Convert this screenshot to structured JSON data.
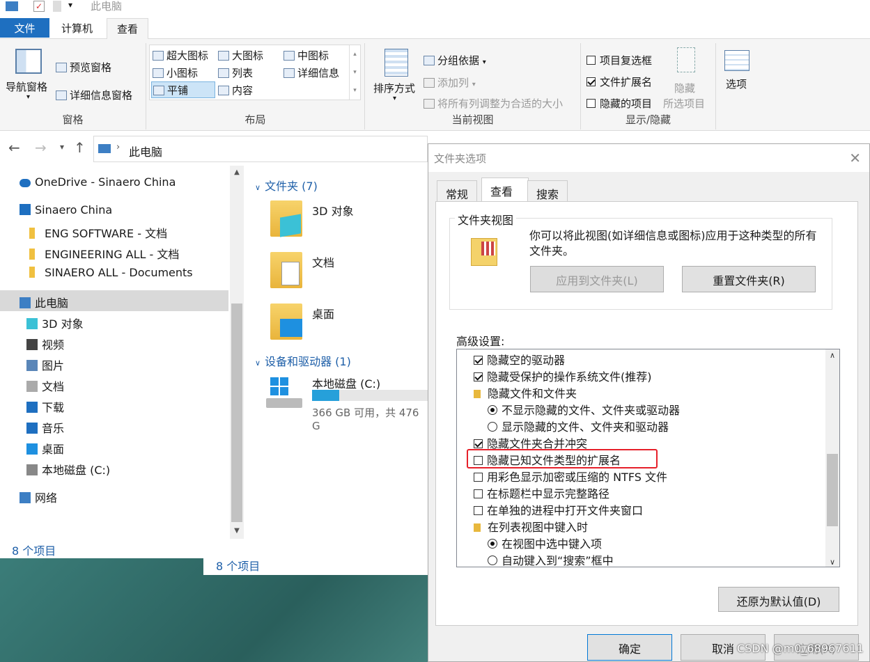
{
  "window": {
    "title": "此电脑"
  },
  "ribbon": {
    "tabs": [
      "文件",
      "计算机",
      "查看"
    ],
    "panes": {
      "nav_pane": "导航窗格",
      "preview": "预览窗格",
      "details": "详细信息窗格",
      "label": "窗格"
    },
    "layout": {
      "items": [
        "超大图标",
        "大图标",
        "中图标",
        "小图标",
        "列表",
        "详细信息",
        "平铺",
        "内容"
      ],
      "selected": "平铺",
      "label": "布局"
    },
    "current_view": {
      "sort": "排序方式",
      "group": "分组依据",
      "add_col": "添加列",
      "fit_cols": "将所有列调整为合适的大小",
      "label": "当前视图"
    },
    "show_hide": {
      "item_checkbox": "项目复选框",
      "file_ext": "文件扩展名",
      "hidden_items": "隐藏的项目",
      "hide_btn": "隐藏",
      "hide_btn2": "所选项目",
      "label": "显示/隐藏",
      "file_ext_checked": true,
      "item_checkbox_checked": false,
      "hidden_items_checked": false
    },
    "options": "选项"
  },
  "address": {
    "path": "此电脑"
  },
  "nav": [
    {
      "label": "OneDrive - Sinaero China",
      "icon": "cloud-icon"
    },
    {
      "label": "Sinaero China",
      "icon": "building-icon"
    },
    {
      "label": "ENG SOFTWARE - 文档",
      "icon": "folder-icon"
    },
    {
      "label": "ENGINEERING ALL - 文档",
      "icon": "folder-icon"
    },
    {
      "label": "SINAERO ALL - Documents",
      "icon": "folder-icon"
    },
    {
      "label": "此电脑",
      "icon": "computer-icon"
    },
    {
      "label": "3D 对象",
      "icon": "cube-icon"
    },
    {
      "label": "视频",
      "icon": "video-icon"
    },
    {
      "label": "图片",
      "icon": "picture-icon"
    },
    {
      "label": "文档",
      "icon": "document-icon"
    },
    {
      "label": "下载",
      "icon": "download-icon"
    },
    {
      "label": "音乐",
      "icon": "music-icon"
    },
    {
      "label": "桌面",
      "icon": "desktop-icon"
    },
    {
      "label": "本地磁盘 (C:)",
      "icon": "drive-icon"
    },
    {
      "label": "网络",
      "icon": "network-icon"
    }
  ],
  "content": {
    "folders_header": "文件夹 (7)",
    "folders": [
      "3D 对象",
      "文档",
      "桌面"
    ],
    "drives_header": "设备和驱动器 (1)",
    "drive": {
      "name": "本地磁盘 (C:)",
      "info": "366 GB 可用，共 476 G",
      "used_fraction": 0.23
    }
  },
  "status": {
    "count": "8 个项目",
    "count2": "8 个项目"
  },
  "dialog": {
    "title": "文件夹选项",
    "tabs": [
      "常规",
      "查看",
      "搜索"
    ],
    "folder_view": {
      "label": "文件夹视图",
      "desc": "你可以将此视图(如详细信息或图标)应用于这种类型的所有文件夹。",
      "apply": "应用到文件夹(L)",
      "reset": "重置文件夹(R)"
    },
    "advanced_label": "高级设置:",
    "advanced": [
      {
        "type": "check",
        "checked": true,
        "label": "隐藏空的驱动器"
      },
      {
        "type": "check",
        "checked": true,
        "label": "隐藏受保护的操作系统文件(推荐)"
      },
      {
        "type": "folder",
        "label": "隐藏文件和文件夹"
      },
      {
        "type": "radio",
        "checked": true,
        "label": "不显示隐藏的文件、文件夹或驱动器"
      },
      {
        "type": "radio",
        "checked": false,
        "label": "显示隐藏的文件、文件夹和驱动器"
      },
      {
        "type": "check",
        "checked": true,
        "label": "隐藏文件夹合并冲突"
      },
      {
        "type": "check",
        "checked": false,
        "label": "隐藏已知文件类型的扩展名"
      },
      {
        "type": "check",
        "checked": false,
        "label": "用彩色显示加密或压缩的 NTFS 文件"
      },
      {
        "type": "check",
        "checked": false,
        "label": "在标题栏中显示完整路径"
      },
      {
        "type": "check",
        "checked": false,
        "label": "在单独的进程中打开文件夹窗口"
      },
      {
        "type": "folder",
        "label": "在列表视图中键入时"
      },
      {
        "type": "radio",
        "checked": true,
        "label": "在视图中选中键入项"
      },
      {
        "type": "radio",
        "checked": false,
        "label": "自动键入到“搜索”框中"
      }
    ],
    "restore": "还原为默认值(D)",
    "ok": "确定",
    "cancel": "取消",
    "apply": "应用(A)"
  },
  "watermark": "CSDN @m0_68967611"
}
